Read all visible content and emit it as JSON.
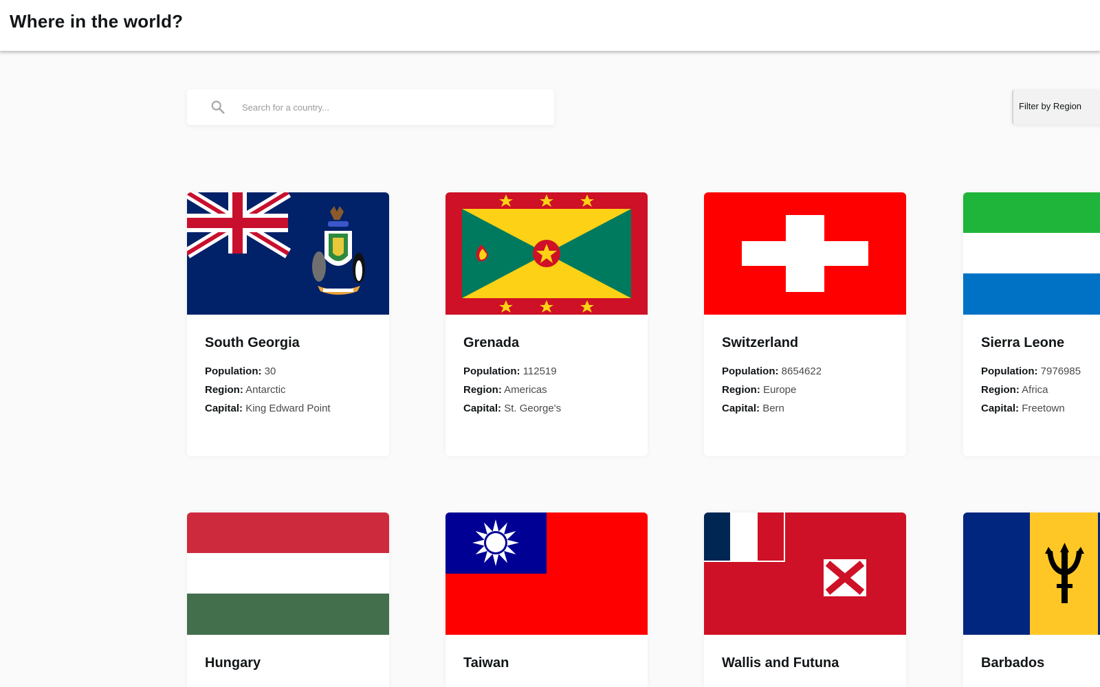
{
  "header": {
    "title": "Where in the world?"
  },
  "search": {
    "placeholder": "Search for a country..."
  },
  "filter": {
    "label": "Filter by Region"
  },
  "labels": {
    "population": "Population:",
    "region": "Region:",
    "capital": "Capital:"
  },
  "countries": [
    {
      "name": "South Georgia",
      "population": "30",
      "region": "Antarctic",
      "capital": "King Edward Point"
    },
    {
      "name": "Grenada",
      "population": "112519",
      "region": "Americas",
      "capital": "St. George's"
    },
    {
      "name": "Switzerland",
      "population": "8654622",
      "region": "Europe",
      "capital": "Bern"
    },
    {
      "name": "Sierra Leone",
      "population": "7976985",
      "region": "Africa",
      "capital": "Freetown"
    },
    {
      "name": "Hungary",
      "population": "",
      "region": "",
      "capital": ""
    },
    {
      "name": "Taiwan",
      "population": "",
      "region": "",
      "capital": ""
    },
    {
      "name": "Wallis and Futuna",
      "population": "",
      "region": "",
      "capital": ""
    },
    {
      "name": "Barbados",
      "population": "",
      "region": "",
      "capital": ""
    }
  ],
  "colors": {
    "background": "#fafafa",
    "card": "#ffffff",
    "text": "#111517"
  }
}
